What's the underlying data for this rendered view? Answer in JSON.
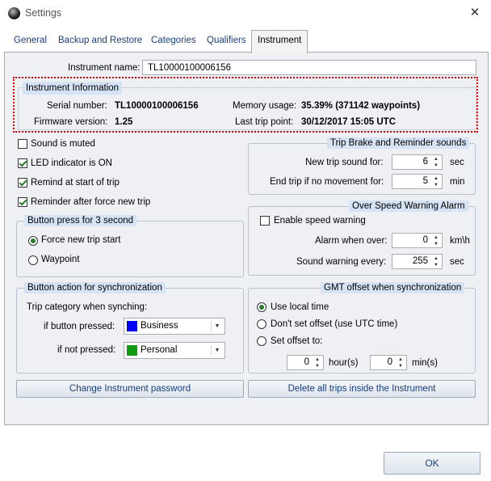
{
  "window": {
    "title": "Settings",
    "close_glyph": "✕"
  },
  "tabs": [
    {
      "label": "General"
    },
    {
      "label": "Backup and Restore"
    },
    {
      "label": "Categories"
    },
    {
      "label": "Qualifiers"
    },
    {
      "label": "Instrument",
      "active": true
    }
  ],
  "instrument": {
    "name_label": "Instrument name:",
    "name_value": "TL10000100006156",
    "info": {
      "heading": "Instrument Information",
      "serial_label": "Serial number:",
      "serial_value": "TL10000100006156",
      "firmware_label": "Firmware version:",
      "firmware_value": "1.25",
      "memory_label": "Memory usage:",
      "memory_value": "35.39% (371142 waypoints)",
      "lasttrip_label": "Last trip point:",
      "lasttrip_value": "30/12/2017 15:05 UTC"
    }
  },
  "options": {
    "sound_muted": {
      "label": "Sound is muted",
      "checked": false
    },
    "led_on": {
      "label": "LED indicator is ON",
      "checked": true
    },
    "remind_start": {
      "label": "Remind at start of trip",
      "checked": true
    },
    "reminder_force": {
      "label": "Reminder after force new trip",
      "checked": true
    }
  },
  "button_press": {
    "title": "Button press for 3 second",
    "force_new_trip": {
      "label": "Force new trip start",
      "selected": true
    },
    "waypoint": {
      "label": "Waypoint",
      "selected": false
    }
  },
  "sync_action": {
    "title": "Button action for synchronization",
    "category_label": "Trip category when synching:",
    "pressed_label": "if button pressed:",
    "pressed_value": "Business",
    "pressed_color": "#0000ff",
    "not_pressed_label": "if not pressed:",
    "not_pressed_value": "Personal",
    "not_pressed_color": "#109c10",
    "dropdown_icon": "chevron-down-icon"
  },
  "trip_brake": {
    "title": "Trip Brake and Reminder sounds",
    "new_trip_label": "New trip sound for:",
    "new_trip_value": "6",
    "new_trip_unit": "sec",
    "end_trip_label": "End trip if no movement for:",
    "end_trip_value": "5",
    "end_trip_unit": "min"
  },
  "overspeed": {
    "title": "Over Speed Warning Alarm",
    "enable_label": "Enable speed warning",
    "enabled": false,
    "alarm_label": "Alarm when over:",
    "alarm_value": "0",
    "alarm_unit": "km\\h",
    "sound_label": "Sound warning every:",
    "sound_value": "255",
    "sound_unit": "sec"
  },
  "gmt": {
    "title": "GMT offset when synchronization",
    "use_local": {
      "label": "Use local time",
      "selected": true
    },
    "utc": {
      "label": "Don't set offset (use UTC time)",
      "selected": false
    },
    "set_offset": {
      "label": "Set offset to:",
      "selected": false
    },
    "hours_value": "0",
    "hours_unit": "hour(s)",
    "mins_value": "0",
    "mins_unit": "min(s)"
  },
  "actions": {
    "change_password": "Change Instrument password",
    "delete_trips": "Delete all trips inside the Instrument",
    "ok": "OK"
  },
  "spin_up": "▲",
  "spin_down": "▼"
}
